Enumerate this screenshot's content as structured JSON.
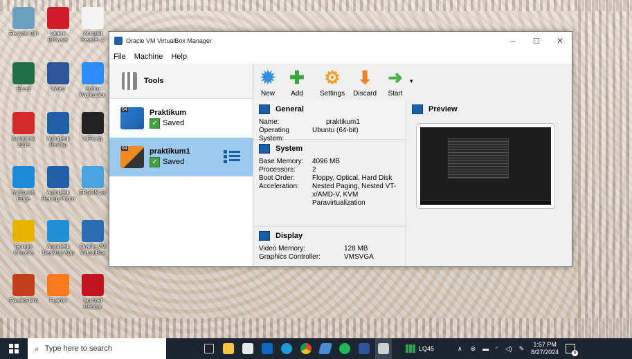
{
  "desktop": {
    "icons": [
      {
        "label": "Recycle Bin",
        "color": "#6aa0c0"
      },
      {
        "label": "Opera Browser",
        "color": "#d11a2a"
      },
      {
        "label": "Acrobat Reader X",
        "color": "#f4f4f4"
      },
      {
        "label": "Excel",
        "color": "#1e7145"
      },
      {
        "label": "Word",
        "color": "#2b579a"
      },
      {
        "label": "Zoom Workplace",
        "color": "#2d8cff"
      },
      {
        "label": "Autodesk 2019",
        "color": "#d52a2a"
      },
      {
        "label": "Autodesk ReCap",
        "color": "#1f5fa8"
      },
      {
        "label": "KiPCap",
        "color": "#222222"
      },
      {
        "label": "Microsoft Edge",
        "color": "#1b8ad8"
      },
      {
        "label": "Autodesk ReCap Photo",
        "color": "#1f5fa8"
      },
      {
        "label": "EPSON Sc",
        "color": "#4aa3df"
      },
      {
        "label": "Google Chrome",
        "color": "#e8b400"
      },
      {
        "label": "Autodesk Desktop App",
        "color": "#1f8fd6"
      },
      {
        "label": "Oracle VM VirtualBox",
        "color": "#2a6db0"
      },
      {
        "label": "PowerPoint",
        "color": "#c43e1c"
      },
      {
        "label": "Firefox",
        "color": "#ff7a1a"
      },
      {
        "label": "Acrobat Reader",
        "color": "#c1121f"
      }
    ]
  },
  "window": {
    "title": "Oracle VM VirtualBox Manager",
    "min": "–",
    "max": "☐",
    "close": "✕"
  },
  "menu": [
    "File",
    "Machine",
    "Help"
  ],
  "sidebar": {
    "tools_label": "Tools",
    "vms": [
      {
        "name": "Praktikum",
        "state": "Saved",
        "badge": "64"
      },
      {
        "name": "praktikum1",
        "state": "Saved",
        "badge": "64"
      }
    ]
  },
  "toolbar": [
    {
      "label": "New",
      "icon": "new-icon",
      "glyph": "✹",
      "color": "#2f8fe0"
    },
    {
      "label": "Add",
      "icon": "add-icon",
      "glyph": "✚",
      "color": "#3aa83a"
    },
    {
      "label": "Settings",
      "icon": "settings-icon",
      "glyph": "⚙",
      "color": "#f0a020"
    },
    {
      "label": "Discard",
      "icon": "discard-icon",
      "glyph": "⬇",
      "color": "#f08020"
    },
    {
      "label": "Start",
      "icon": "start-icon",
      "glyph": "➜",
      "color": "#4cb04c"
    }
  ],
  "general": {
    "heading": "General",
    "name_k": "Name:",
    "name_v": "praktikum1",
    "os_k": "Operating System:",
    "os_v": "Ubuntu (64-bit)"
  },
  "system": {
    "heading": "System",
    "mem_k": "Base Memory:",
    "mem_v": "4096 MB",
    "proc_k": "Processors:",
    "proc_v": "2",
    "boot_k": "Boot Order:",
    "boot_v": "Floppy, Optical, Hard Disk",
    "accel_k": "Acceleration:",
    "accel_v": "Nested Paging, Nested VT-x/AMD-V, KVM Paravirtualization"
  },
  "display": {
    "heading": "Display",
    "vmem_k": "Video Memory:",
    "vmem_v": "128 MB",
    "gc_k": "Graphics Controller:",
    "gc_v": "VMSVGA"
  },
  "preview": {
    "heading": "Preview"
  },
  "taskbar": {
    "search_placeholder": "Type here to search",
    "weather": "LQ45",
    "time": "1:57 PM",
    "date": "8/27/2024",
    "notif_count": "6"
  }
}
